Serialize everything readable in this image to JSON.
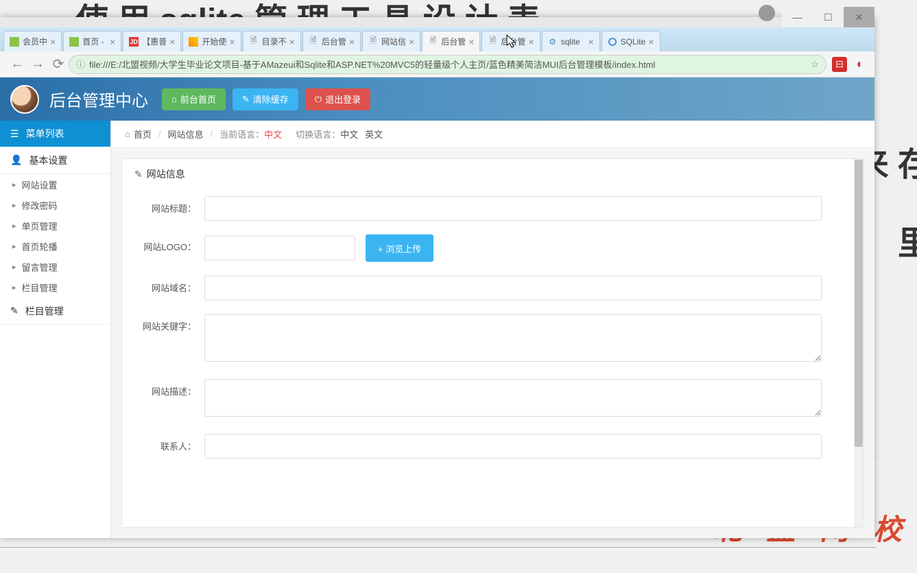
{
  "bg": {
    "top_text": "使 用 sqlite 管 理 工 具 设 计 表",
    "right1": "来 存",
    "right2": "里",
    "watermark": "北 盟 网 校"
  },
  "window": {
    "minimize": "—",
    "maximize": "☐",
    "close": "✕"
  },
  "tabs": [
    {
      "label": "会员中",
      "favclass": "fav-green"
    },
    {
      "label": "首页 -",
      "favclass": "fav-green"
    },
    {
      "label": "【惠普",
      "favclass": "fav-red",
      "favtext": "JD"
    },
    {
      "label": "开始使",
      "favclass": "fav-orange"
    },
    {
      "label": "目录不",
      "favclass": "fav-doc",
      "favtext": "🗎"
    },
    {
      "label": "后台管",
      "favclass": "fav-doc",
      "favtext": "🗎"
    },
    {
      "label": "网站信",
      "favclass": "fav-doc",
      "favtext": "🗎"
    },
    {
      "label": "后台管",
      "favclass": "fav-doc",
      "favtext": "🗎",
      "active": true
    },
    {
      "label": "后台管",
      "favclass": "fav-doc",
      "favtext": "🗎"
    },
    {
      "label": "sqlite",
      "favclass": "fav-paw",
      "favtext": "⚙"
    },
    {
      "label": "SQLite",
      "favclass": "",
      "favtext": ""
    }
  ],
  "addr": {
    "back": "←",
    "forward": "→",
    "reload": "⟳",
    "info": "ⓘ",
    "url": "file:///E:/北盟视频/大学生毕业论文项目-基于AMazeui和Sqlite和ASP.NET%20MVC5的轻量级个人主页/蓝色精美简洁MUI后台管理模板/index.html",
    "star": "☆",
    "ext_red": "曰",
    "ext_stop": "◐"
  },
  "header": {
    "title": "后台管理中心",
    "home": "前台首页",
    "clear": "清除缓存",
    "logout": "退出登录"
  },
  "sidebar": {
    "menu_header": "菜单列表",
    "cat_basic": "基本设置",
    "items": [
      "网站设置",
      "修改密码",
      "单页管理",
      "首页轮播",
      "留言管理",
      "栏目管理"
    ],
    "cat_column": "栏目管理"
  },
  "breadcrumb": {
    "home": "首页",
    "page": "网站信息",
    "cur_lang_label": "当前语言：",
    "cur_lang": "中文",
    "switch_label": "切换语言：",
    "lang_cn": "中文",
    "lang_en": "英文"
  },
  "panel": {
    "title": "网站信息",
    "labels": {
      "site_title": "网站标题：",
      "site_logo": "网站LOGO：",
      "domain": "网站域名：",
      "keywords": "网站关键字：",
      "desc": "网站描述：",
      "contact": "联系人："
    },
    "upload_btn": "+ 浏览上传"
  }
}
